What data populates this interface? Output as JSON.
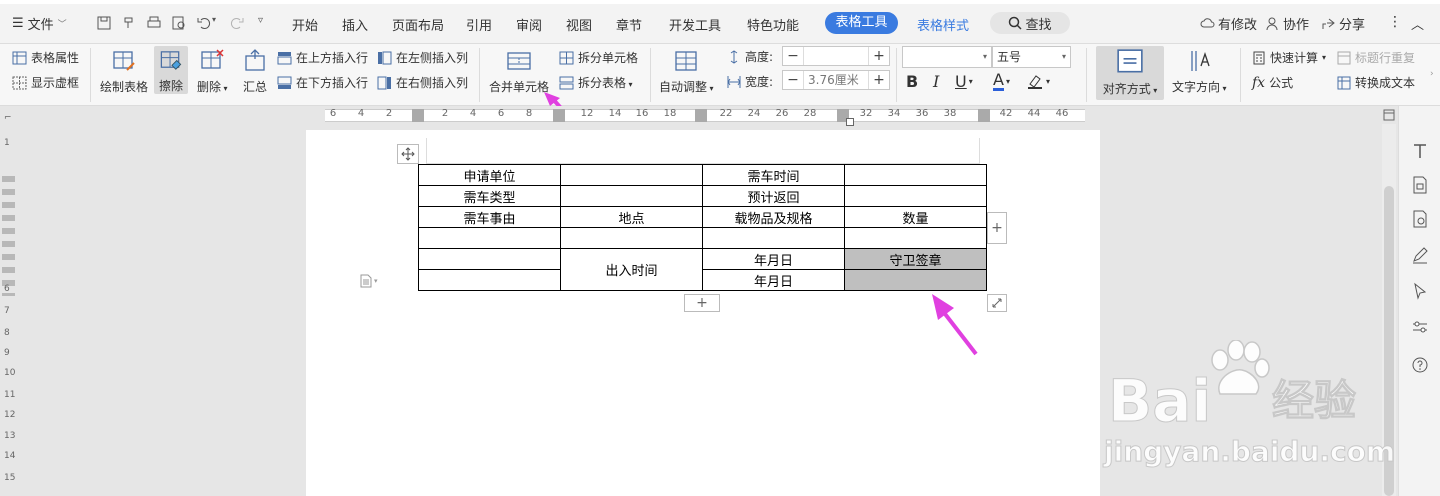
{
  "menubar": {
    "file_label": "文件",
    "tabs": [
      "开始",
      "插入",
      "页面布局",
      "引用",
      "审阅",
      "视图",
      "章节",
      "开发工具",
      "特色功能"
    ],
    "active_tab": "表格工具",
    "secondary_tab": "表格样式",
    "search_label": "查找",
    "status_label": "有修改",
    "collab_label": "协作",
    "share_label": "分享"
  },
  "ribbon": {
    "table_props": "表格属性",
    "show_gridlines": "显示虚框",
    "draw_table": "绘制表格",
    "erase": "擦除",
    "delete": "删除",
    "summary": "汇总",
    "insert_above": "在上方插入行",
    "insert_below": "在下方插入行",
    "insert_left": "在左侧插入列",
    "insert_right": "在右侧插入列",
    "merge_cells": "合并单元格",
    "split_cells": "拆分单元格",
    "split_table": "拆分表格",
    "autofit": "自动调整",
    "height_label": "高度:",
    "height_value": "",
    "width_label": "宽度:",
    "width_value": "3.76厘米",
    "font_name": "",
    "font_size": "五号",
    "bold": "B",
    "italic": "I",
    "underline": "U",
    "font_color": "A",
    "align": "对齐方式",
    "text_direction": "文字方向",
    "quick_calc": "快速计算",
    "formula": "公式",
    "repeat_header": "标题行重复",
    "convert_text": "转换成文本"
  },
  "ruler": {
    "numbers": [
      "6",
      "4",
      "2",
      "2",
      "4",
      "6",
      "8",
      "12",
      "14",
      "16",
      "18",
      "22",
      "24",
      "26",
      "28",
      "32",
      "34",
      "36",
      "38",
      "42",
      "44",
      "46"
    ]
  },
  "vruler": {
    "numbers": [
      "1",
      "6",
      "7",
      "8",
      "9",
      "10",
      "11",
      "12",
      "13",
      "14",
      "15"
    ]
  },
  "table": {
    "rows": [
      [
        "申请单位",
        "",
        "需车时间",
        ""
      ],
      [
        "需车类型",
        "",
        "预计返回",
        ""
      ],
      [
        "需车事由",
        "地点",
        "载物品及规格",
        "数量"
      ],
      [
        "",
        "",
        "",
        ""
      ]
    ],
    "merged_label": "出入时间",
    "date_1": "年月日",
    "date_2": "年月日",
    "guard_seal": "守卫签章"
  },
  "watermark": {
    "brand": "Bai",
    "brand_cn": "经验",
    "url": "jingyan.baidu.com"
  },
  "colors": {
    "accent": "#3a7be0",
    "arrow": "#e040e0",
    "cell_selected": "#bfbfbf"
  }
}
